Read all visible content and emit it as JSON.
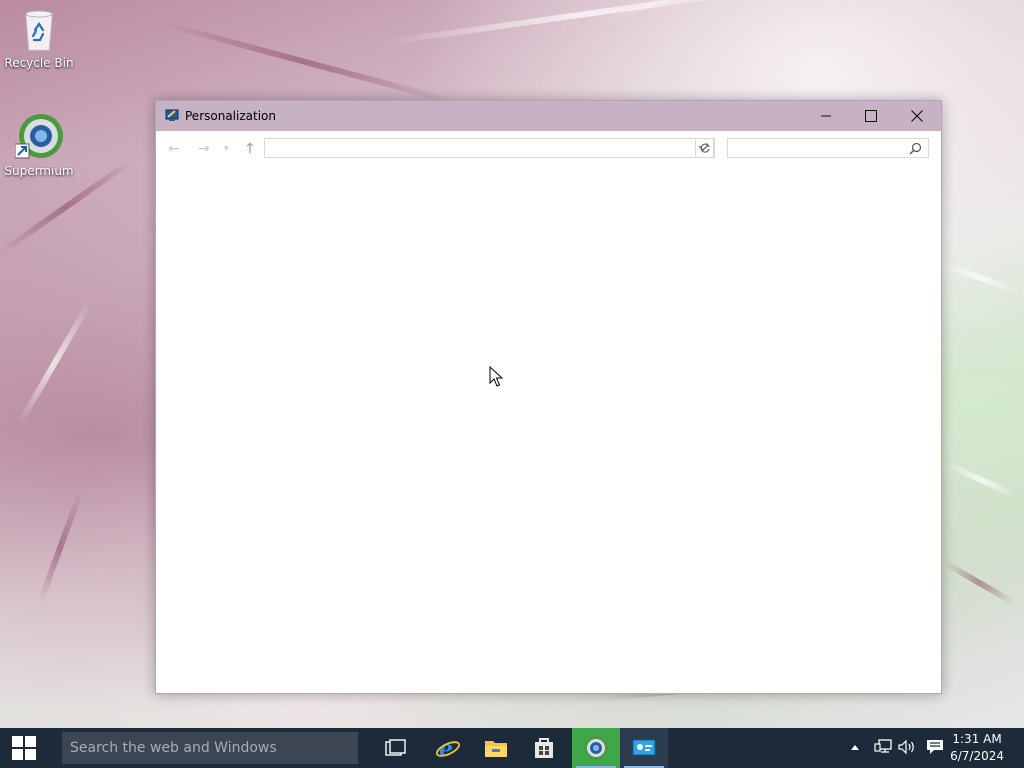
{
  "desktop": {
    "icons": [
      {
        "label": "Recycle Bin",
        "icon": "recycle-bin-icon"
      },
      {
        "label": "Supermium",
        "icon": "supermium-icon"
      }
    ]
  },
  "window": {
    "title": "Personalization",
    "icon": "personalization-icon",
    "controls": [
      "minimize-icon",
      "maximize-icon",
      "close-icon"
    ],
    "address_value": "",
    "search_placeholder": ""
  },
  "taskbar": {
    "search_placeholder": "Search the web and Windows",
    "apps": [
      "task-view-icon",
      "internet-explorer-icon",
      "file-explorer-icon",
      "store-icon",
      "supermium-icon",
      "control-panel-icon"
    ],
    "clock_time": "1:31 AM",
    "clock_date": "6/7/2024"
  },
  "colors": {
    "titlebar": "#c7b2c3",
    "taskbar": "#1c2a3a",
    "active_app": "#3fa64a"
  }
}
